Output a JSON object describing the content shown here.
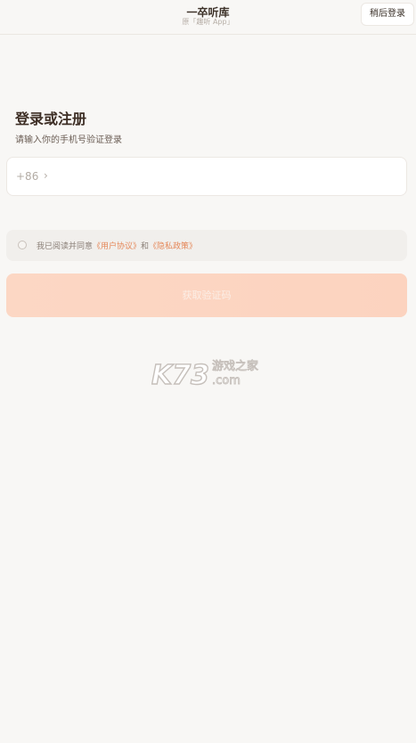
{
  "header": {
    "title": "一卒听库",
    "subtitle": "原「趣听 App」",
    "later_login_label": "稍后登录"
  },
  "login": {
    "heading": "登录或注册",
    "hint": "请输入你的手机号验证登录",
    "country_code": "+86",
    "phone_value": "",
    "phone_placeholder": ""
  },
  "agreement": {
    "prefix": "我已阅读并同意",
    "user_agreement": "《用户协议》",
    "conjunction": "和",
    "privacy_policy": "《隐私政策》"
  },
  "submit": {
    "label": "获取验证码"
  },
  "watermark": {
    "logo_text": "K73",
    "site_name": "游戏之家",
    "domain": ".com"
  },
  "colors": {
    "background": "#f8f7f5",
    "accent_link": "#e5885a",
    "button_gradient": "#fcd7c4"
  }
}
